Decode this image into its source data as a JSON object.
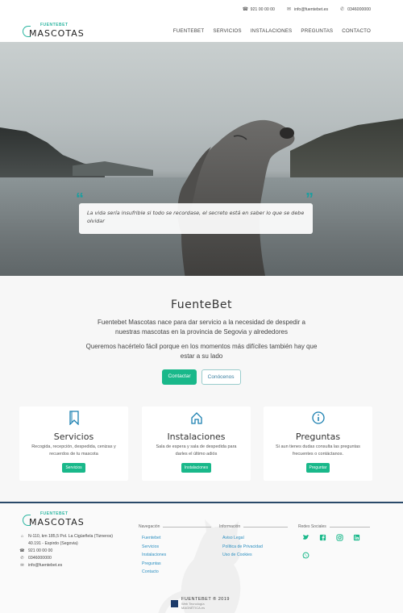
{
  "topbar": {
    "phone": "921 00 00 00",
    "email": "info@fuentebet.es",
    "whatsapp": "0346000000"
  },
  "brand": {
    "tagline": "FUENTEBET",
    "name": "MASCOTAS"
  },
  "nav": {
    "items": [
      "FUENTEBET",
      "SERVICIOS",
      "INSTALACIONES",
      "PREGUNTAS",
      "CONTACTO"
    ]
  },
  "hero": {
    "quote": "La vida sería insufrible si todo se recordase, el secreto está en saber lo que se debe olvidar"
  },
  "about": {
    "title": "FuenteBet",
    "p1": "Fuentebet Mascotas nace para dar servicio a la necesidad de despedir a nuestras mascotas en la provincia de Segovia y alrededores",
    "p2": "Queremos hacértelo fácil porque en los momentos más difíciles también hay que estar a su lado",
    "primary_button": "Contactar",
    "secondary_button": "Conócenos"
  },
  "services": [
    {
      "icon": "bookmark-icon",
      "title": "Servicios",
      "text": "Recogida, recepción, despedida, cenizas y recuerdos de tu mascota",
      "button": "Servicios"
    },
    {
      "icon": "home-icon",
      "title": "Instalaciones",
      "text": "Sala de espera y sala de despedida para darles el último adiós",
      "button": "Instalaciones"
    },
    {
      "icon": "info-icon",
      "title": "Preguntas",
      "text": "Si aun tienes dudas consulta las preguntas frecuentes o contáctanos.",
      "button": "Preguntar"
    }
  ],
  "footer": {
    "address_line1": "N-110, km 185,5 Pol. La Cigüeñela (Tizneros)",
    "address_line2": "40.191 - Espirdo (Segovia)",
    "phone": "921 00 00 00",
    "whatsapp": "0346000000",
    "email": "info@fuentebet.es",
    "nav_heading": "Navegación",
    "nav_links": [
      "Fuentebet",
      "Servicios",
      "Instalaciones",
      "Preguntas",
      "Contacto"
    ],
    "info_heading": "Información",
    "info_links": [
      "Aviso Legal",
      "Política de Privacidad",
      "Uso de Cookies"
    ],
    "social_heading": "Redes Sociales",
    "social_icons": [
      "twitter-icon",
      "facebook-icon",
      "instagram-icon",
      "linkedin-icon",
      "whatsapp-icon"
    ],
    "credit_name": "FUENTEBET ® 2019",
    "credit_sub1": "Web Tecnología",
    "credit_sub2": "MAGNÉTICA.es"
  },
  "colors": {
    "accent": "#19b88a",
    "teal": "#2bb5a0",
    "navy": "#2a4a6a"
  }
}
